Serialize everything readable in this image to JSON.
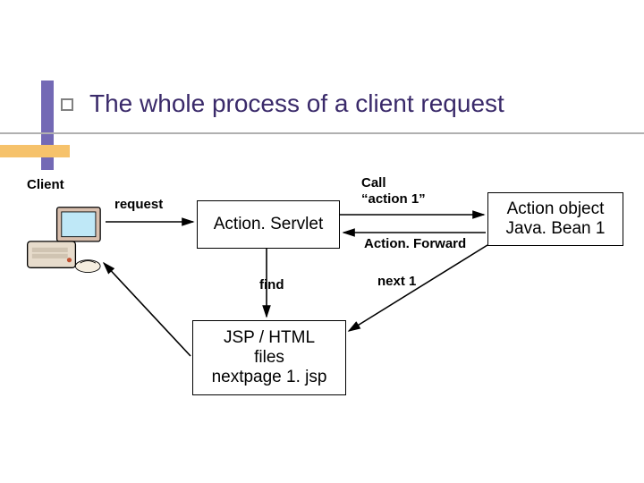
{
  "title": "The whole process of a client request",
  "nodes": {
    "client_label": "Client",
    "servlet": "Action. Servlet",
    "action_object_l1": "Action object",
    "action_object_l2": "Java. Bean 1",
    "jsp_l1": "JSP / HTML",
    "jsp_l2": "files",
    "jsp_l3": "nextpage 1. jsp"
  },
  "edges": {
    "request": "request",
    "call_l1": "Call",
    "call_l2": "“action 1”",
    "forward": "Action. Forward",
    "find": "find",
    "next": "next 1"
  }
}
